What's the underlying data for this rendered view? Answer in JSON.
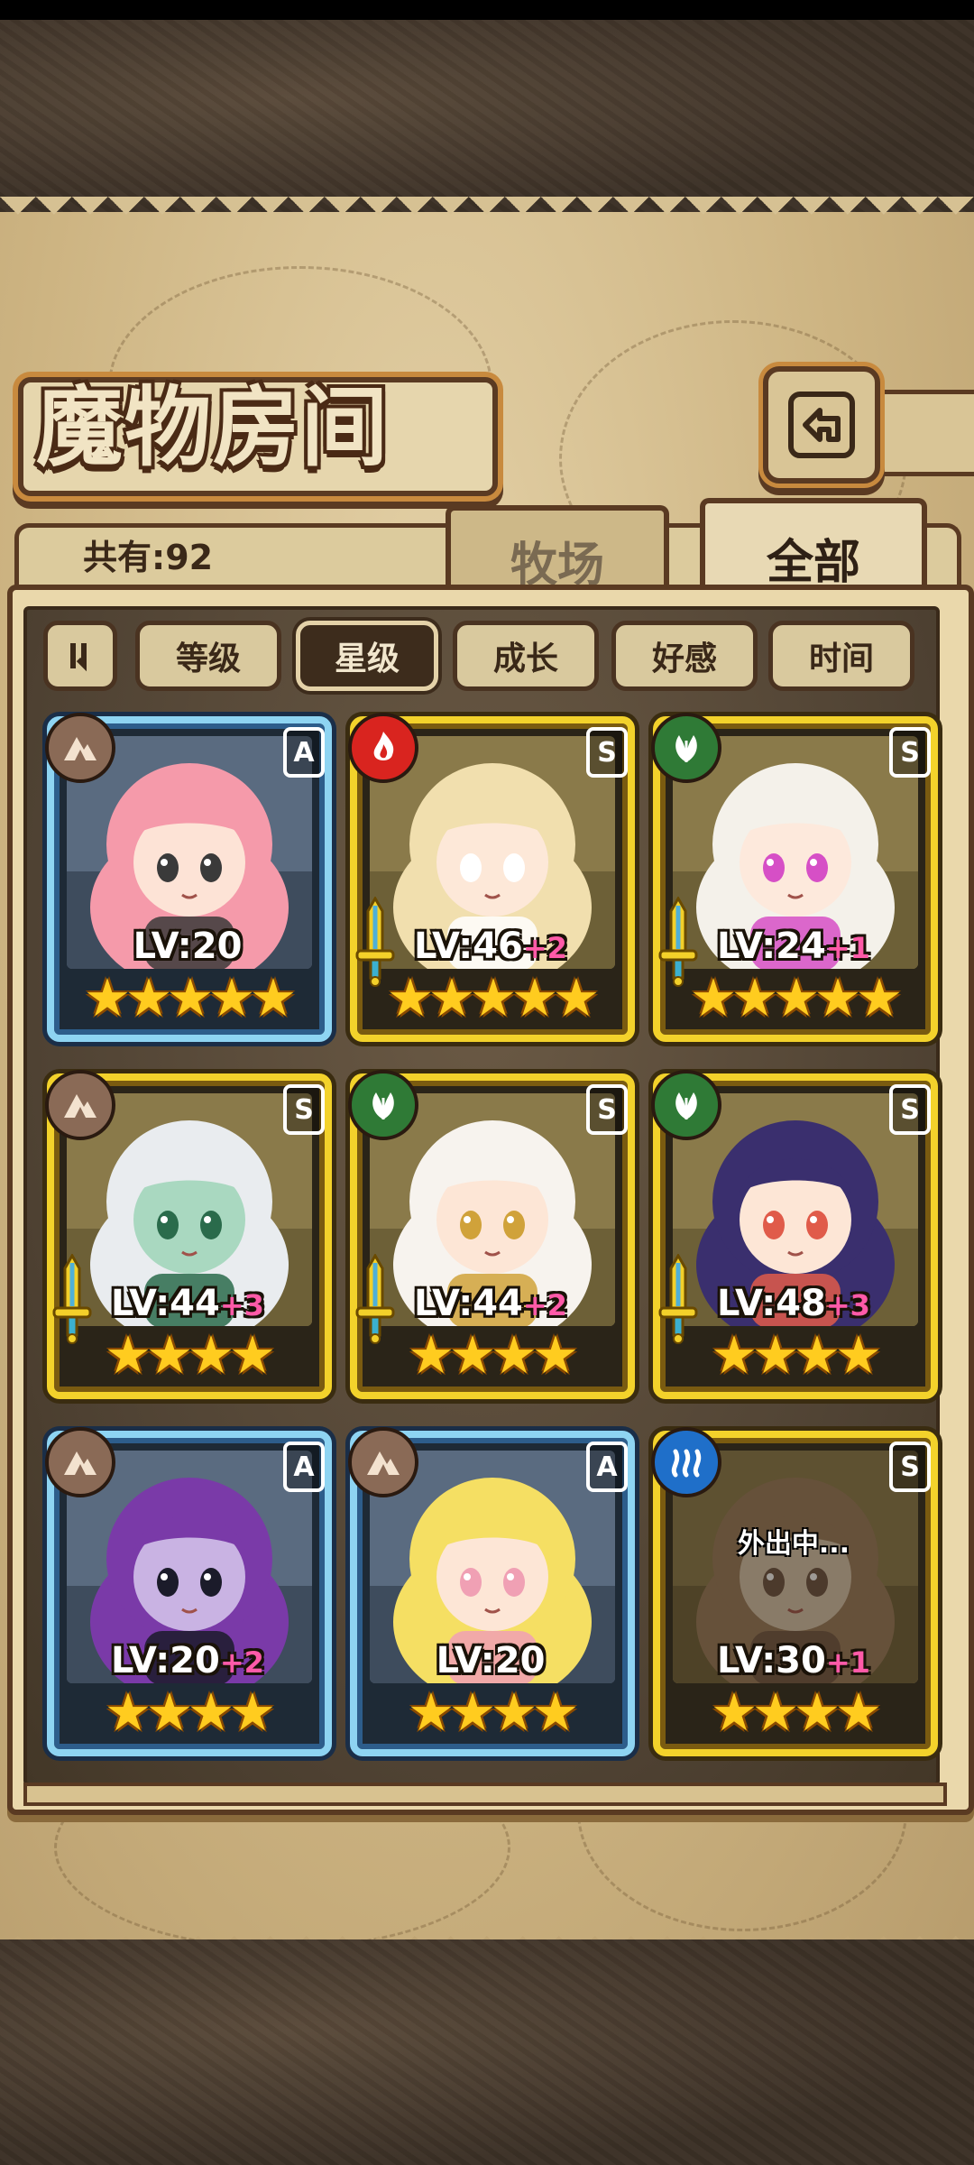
{
  "header": {
    "title": "魔物房间",
    "count_text": "共有:92",
    "tabs": [
      {
        "label": "牧场",
        "active": false
      },
      {
        "label": "全部",
        "active": true
      }
    ]
  },
  "sort_buttons": [
    {
      "label": "等级",
      "active": false
    },
    {
      "label": "星级",
      "active": true
    },
    {
      "label": "成长",
      "active": false
    },
    {
      "label": "好感",
      "active": false
    },
    {
      "label": "时间",
      "active": false
    }
  ],
  "monsters": [
    {
      "rank": "A",
      "element": "earth",
      "level": "LV:20",
      "plus": "",
      "stars": "★★★★★",
      "frame": "blue",
      "weapon": false,
      "status": "",
      "hair": "#f59aaa",
      "skin": "#fde3d6",
      "accent": "#3a3a3a"
    },
    {
      "rank": "S",
      "element": "fire",
      "level": "LV:46",
      "plus": "+2",
      "stars": "★★★★★",
      "frame": "gold",
      "weapon": true,
      "status": "",
      "hair": "#f1dfae",
      "skin": "#fde8d8",
      "accent": "#ffffff"
    },
    {
      "rank": "S",
      "element": "nature",
      "level": "LV:24",
      "plus": "+1",
      "stars": "★★★★★",
      "frame": "gold",
      "weapon": true,
      "status": "",
      "hair": "#f4f1ea",
      "skin": "#fde9dc",
      "accent": "#d64fc6"
    },
    {
      "rank": "S",
      "element": "earth",
      "level": "LV:44",
      "plus": "+3",
      "stars": "★★★★",
      "frame": "gold",
      "weapon": true,
      "status": "",
      "hair": "#e9ecef",
      "skin": "#a9d8c0",
      "accent": "#2a6b4b"
    },
    {
      "rank": "S",
      "element": "nature",
      "level": "LV:44",
      "plus": "+2",
      "stars": "★★★★",
      "frame": "gold",
      "weapon": true,
      "status": "",
      "hair": "#f7f3ee",
      "skin": "#fde6d6",
      "accent": "#d0a23a"
    },
    {
      "rank": "S",
      "element": "nature",
      "level": "LV:48",
      "plus": "+3",
      "stars": "★★★★",
      "frame": "gold",
      "weapon": true,
      "status": "",
      "hair": "#3a2f6e",
      "skin": "#fde6d6",
      "accent": "#e05b4a"
    },
    {
      "rank": "A",
      "element": "earth",
      "level": "LV:20",
      "plus": "+2",
      "stars": "★★★★",
      "frame": "blue",
      "weapon": false,
      "status": "",
      "hair": "#7a3aa8",
      "skin": "#c9b3e3",
      "accent": "#1b1b2a"
    },
    {
      "rank": "A",
      "element": "earth",
      "level": "LV:20",
      "plus": "",
      "stars": "★★★★",
      "frame": "blue",
      "weapon": false,
      "status": "",
      "hair": "#f5df63",
      "skin": "#fde6d6",
      "accent": "#f0a0b4"
    },
    {
      "rank": "S",
      "element": "water",
      "level": "LV:30",
      "plus": "+1",
      "stars": "★★★★",
      "frame": "gold",
      "weapon": false,
      "status": "外出中...",
      "hair": "#9a7a5a",
      "skin": "#d9c6ae",
      "accent": "#6a5040"
    }
  ],
  "colors": {
    "earth": "#8a6a56",
    "fire": "#d9241f",
    "nature": "#2f7a36",
    "water": "#1f6fc9"
  }
}
